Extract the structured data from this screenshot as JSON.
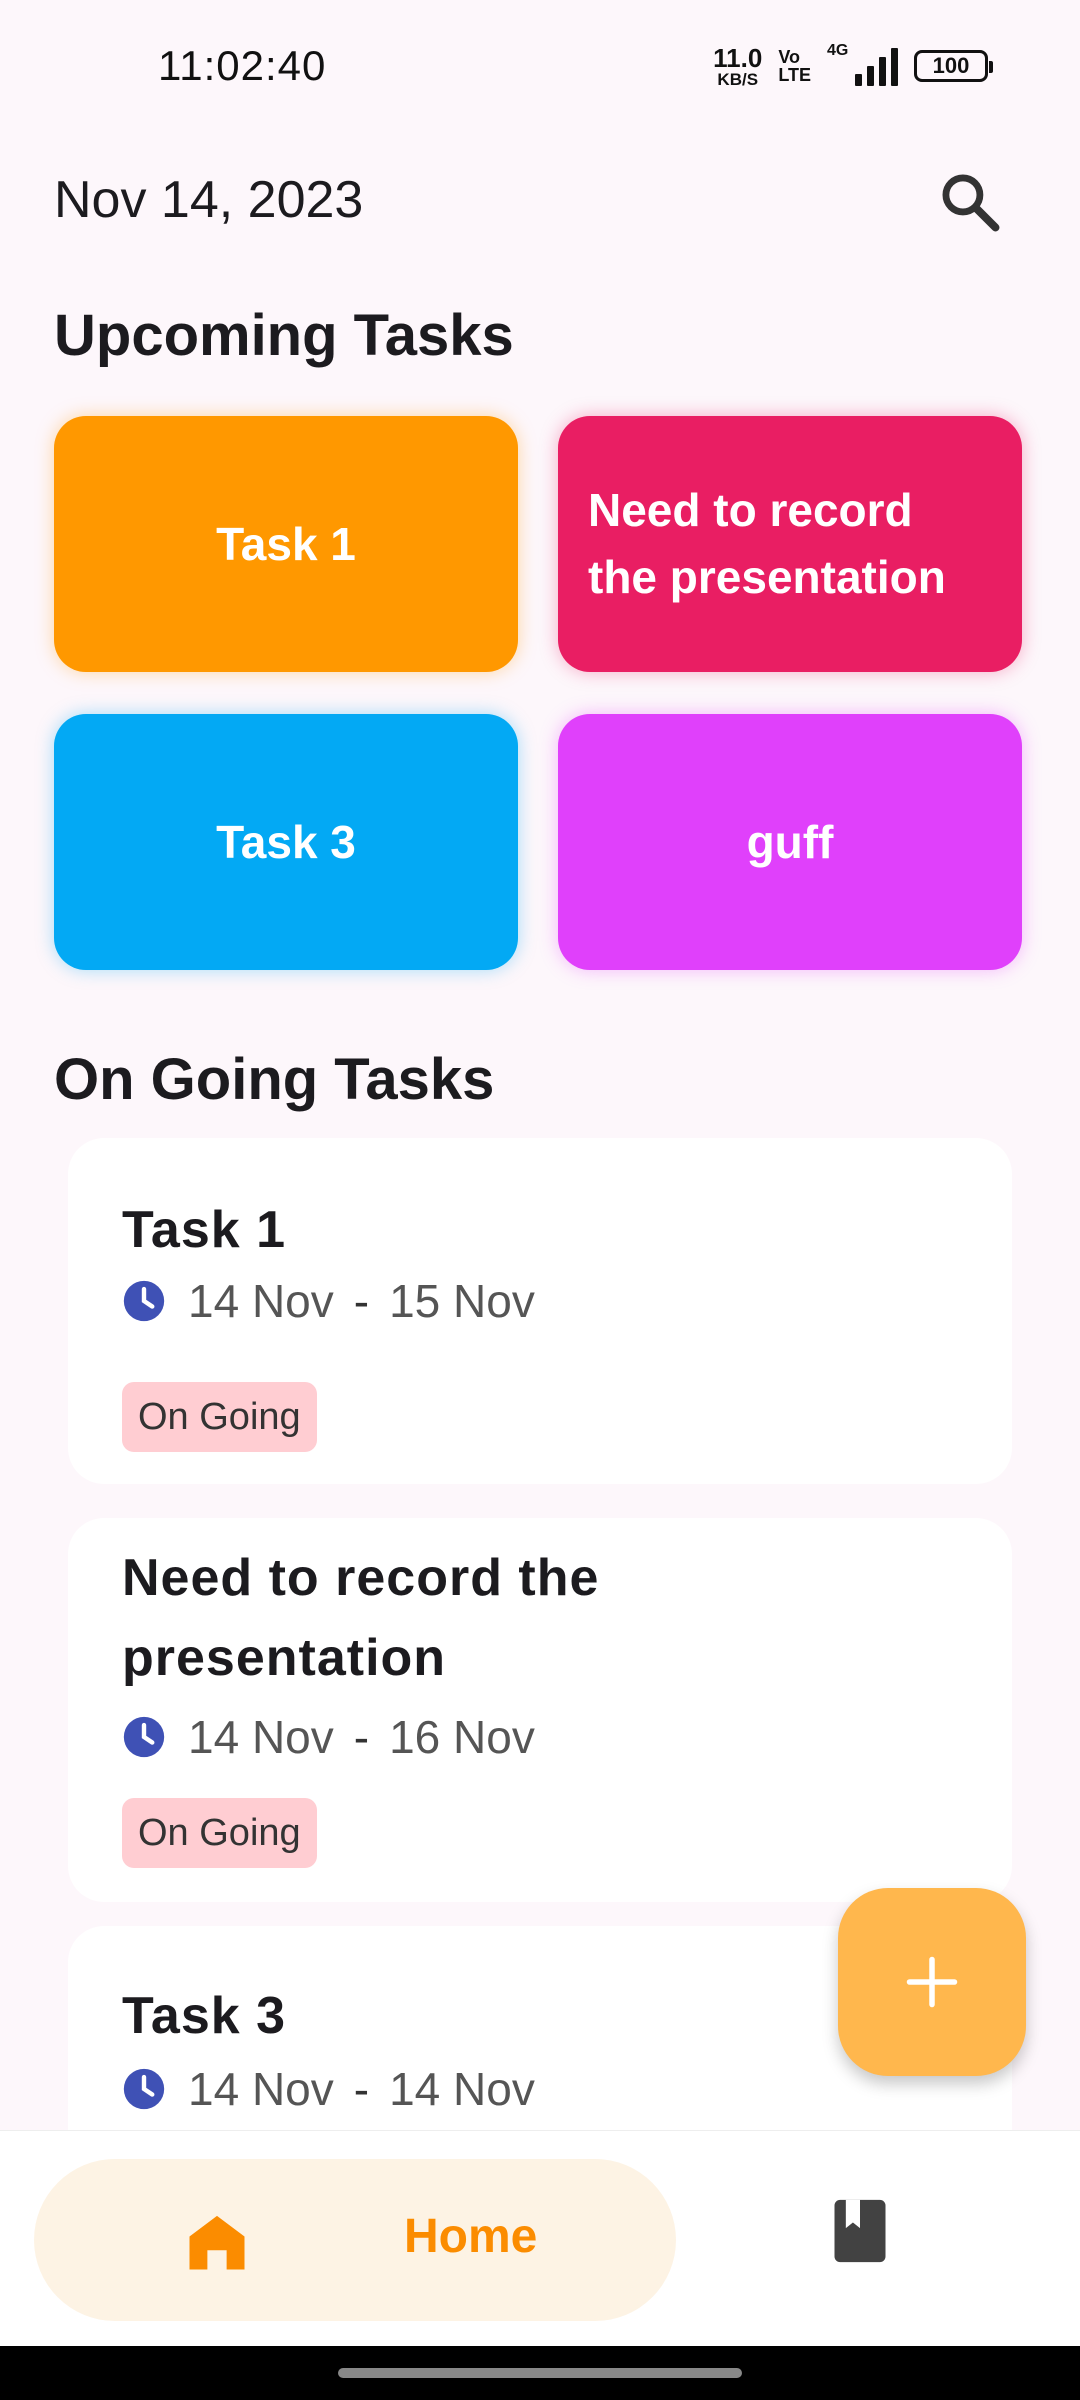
{
  "status_bar": {
    "time": "11:02:40",
    "net_speed_value": "11.0",
    "net_speed_unit": "KB/S",
    "volte_top": "Vo",
    "volte_bottom": "LTE",
    "network_label": "4G",
    "battery": "100"
  },
  "header": {
    "date": "Nov 14, 2023",
    "search_icon": "search-icon"
  },
  "upcoming": {
    "title": "Upcoming Tasks",
    "tiles": [
      {
        "label": "Task 1",
        "color": "#ff9800"
      },
      {
        "label": "Need to record the presentation",
        "color": "#e91e63"
      },
      {
        "label": "Task 3",
        "color": "#03a9f4"
      },
      {
        "label": "guff",
        "color": "#e040fb"
      }
    ]
  },
  "ongoing": {
    "title": "On Going Tasks",
    "cards": [
      {
        "title": "Task 1",
        "start": "14 Nov",
        "end": "15 Nov",
        "status": "On Going"
      },
      {
        "title": "Need to record the presentation",
        "start": "14 Nov",
        "end": "16 Nov",
        "status": "On Going"
      },
      {
        "title": "Task 3",
        "start": "14 Nov",
        "end": "14 Nov",
        "status": ""
      }
    ],
    "date_separator": "-"
  },
  "fab": {
    "icon": "plus-icon",
    "color": "#ffb74d"
  },
  "bottom_nav": {
    "home_label": "Home",
    "home_icon": "home-icon",
    "book_icon": "bookmark-book-icon",
    "accent": "#fb8c00"
  }
}
